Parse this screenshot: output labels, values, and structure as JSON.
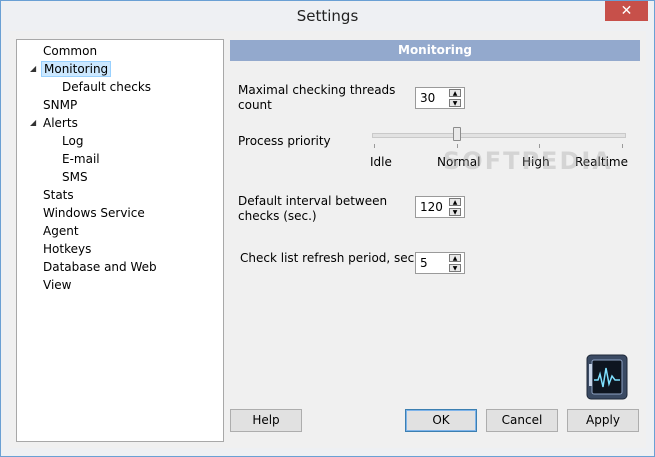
{
  "window": {
    "title": "Settings",
    "close_glyph": "✕"
  },
  "tree": {
    "items": [
      {
        "label": "Common",
        "level": 0
      },
      {
        "label": "Monitoring",
        "level": 0,
        "expanded": true,
        "selected": true
      },
      {
        "label": "Default checks",
        "level": 1
      },
      {
        "label": "SNMP",
        "level": 0
      },
      {
        "label": "Alerts",
        "level": 0,
        "expanded": true
      },
      {
        "label": "Log",
        "level": 1
      },
      {
        "label": "E-mail",
        "level": 1
      },
      {
        "label": "SMS",
        "level": 1
      },
      {
        "label": "Stats",
        "level": 0
      },
      {
        "label": "Windows Service",
        "level": 0
      },
      {
        "label": "Agent",
        "level": 0
      },
      {
        "label": "Hotkeys",
        "level": 0
      },
      {
        "label": "Database and Web",
        "level": 0
      },
      {
        "label": "View",
        "level": 0
      }
    ],
    "expander_glyph": "◢"
  },
  "panel": {
    "header": "Monitoring",
    "threads_label": "Maximal checking threads count",
    "threads_value": "30",
    "priority_label": "Process priority",
    "priority_options": [
      "Idle",
      "Normal",
      "High",
      "Realtime"
    ],
    "priority_selected": "Normal",
    "interval_label": "Default interval between checks (sec.)",
    "interval_value": "120",
    "refresh_label": "Check list refresh period, sec.",
    "refresh_value": "5",
    "watermark": "SOFTPEDIA"
  },
  "buttons": {
    "help": "Help",
    "ok": "OK",
    "cancel": "Cancel",
    "apply": "Apply"
  },
  "colors": {
    "header_bg": "#93a9cd",
    "selection_bg": "#cce8ff",
    "close_bg": "#c7504a"
  }
}
